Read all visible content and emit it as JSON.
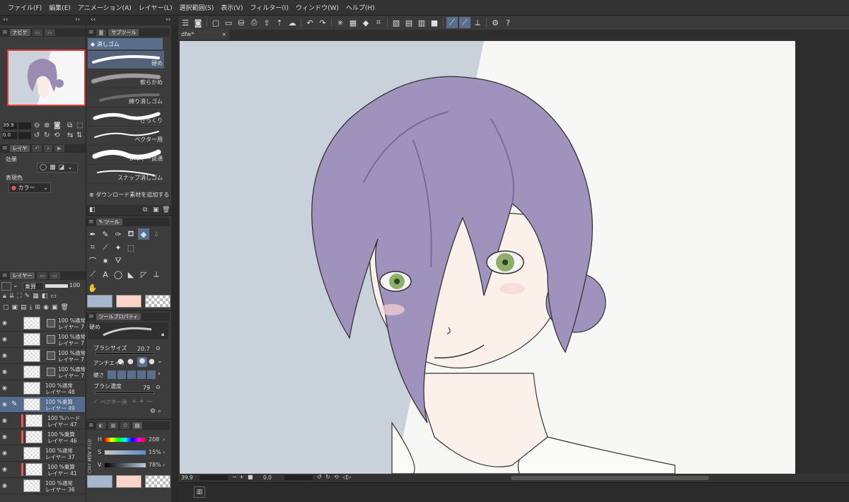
{
  "menu": [
    "ファイル(F)",
    "編集(E)",
    "アニメーション(A)",
    "レイヤー(L)",
    "選択範囲(S)",
    "表示(V)",
    "フィルター(I)",
    "ウィンドウ(W)",
    "ヘルプ(H)"
  ],
  "navigator": {
    "tab1": "ナビゲ",
    "zoom": "39.9",
    "angle": "0.0"
  },
  "subtool": {
    "tab": "サブツール",
    "title": "消しゴム",
    "items": [
      "硬め",
      "軟らかめ",
      "練り消しゴム",
      "ざっくり",
      "ベクター用",
      "レイヤー貫通",
      "スナップ消しゴム"
    ],
    "download": "ダウンロード素材を追加する"
  },
  "layer_prop": {
    "tab": "レイヤ",
    "effect_label": "効果",
    "expression_label": "表現色",
    "expression_value": "カラー"
  },
  "tool": {
    "tab": "ツール"
  },
  "tool_property": {
    "tab": "ツールプロパティ",
    "name": "硬め",
    "brush_size_label": "ブラシサイズ",
    "brush_size": "20.7",
    "antialias_label": "アンチエイリ",
    "hardness_label": "硬さ",
    "density_label": "ブラシ濃度",
    "density": "79",
    "vector_label": "ベクター消"
  },
  "color": {
    "h_label": "H",
    "h": "208",
    "s_label": "S",
    "s": "15%",
    "v_label": "V",
    "v": "78%",
    "side_tabs": [
      "HSV",
      "RGB",
      "CMY"
    ]
  },
  "layers": {
    "tab": "レイヤー",
    "blend": "乗算",
    "opacity": "100",
    "rows": [
      {
        "t1": "100 %通常",
        "t2": "レイヤー 7"
      },
      {
        "t1": "100 %通常",
        "t2": "レイヤー 7"
      },
      {
        "t1": "100 %通常",
        "t2": "レイヤー 7"
      },
      {
        "t1": "100 %通常",
        "t2": "レイヤー 7"
      },
      {
        "t1": "100 %通常",
        "t2": "レイヤー 48"
      },
      {
        "t1": "100 %乗算",
        "t2": "レイヤー 49"
      },
      {
        "t1": "100 %ハード",
        "t2": "レイヤー 47"
      },
      {
        "t1": "100 %乗算",
        "t2": "レイヤー 46"
      },
      {
        "t1": "100 %通常",
        "t2": "レイヤー 37"
      },
      {
        "t1": "100 %乗算",
        "t2": "レイヤー 41"
      },
      {
        "t1": "100 %通常",
        "t2": "レイヤー 36"
      }
    ]
  },
  "canvas": {
    "tab": "dfw*",
    "zoom": "39.9",
    "angle": "0.0"
  },
  "colors": {
    "main": "#a6b6cc",
    "sub": "#fcd5c8",
    "accent": "#5a6f8c"
  }
}
